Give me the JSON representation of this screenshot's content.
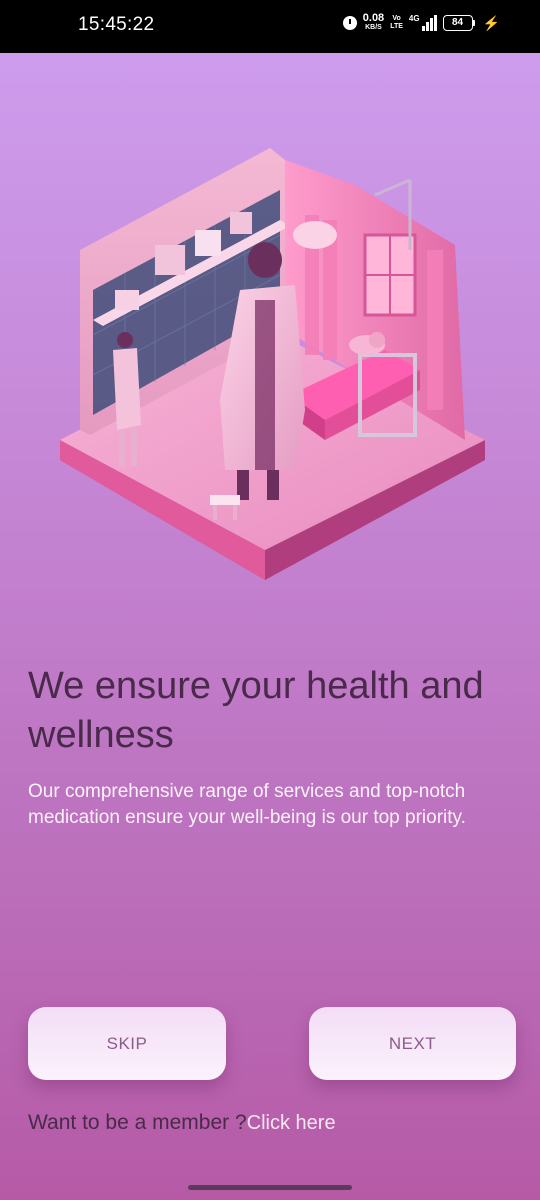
{
  "status_bar": {
    "time": "15:45:22",
    "speed_value": "0.08",
    "speed_unit": "KB/S",
    "volte_top": "Vo",
    "volte_bottom": "LTE",
    "network": "4G",
    "battery": "84"
  },
  "onboarding": {
    "illustration": "hospital-room-illustration",
    "headline": "We ensure your health and wellness",
    "description": "Our comprehensive range of services and top-notch medication ensure your well-being is our top priority."
  },
  "actions": {
    "skip_label": "SKIP",
    "next_label": "NEXT"
  },
  "member": {
    "prompt": "Want to be a member ?",
    "link": "Click here"
  },
  "colors": {
    "gradient_top": "#cf9ff0",
    "gradient_bottom": "#b65aa6",
    "headline": "#4a2a4a",
    "button_text": "#8a5c8a"
  }
}
